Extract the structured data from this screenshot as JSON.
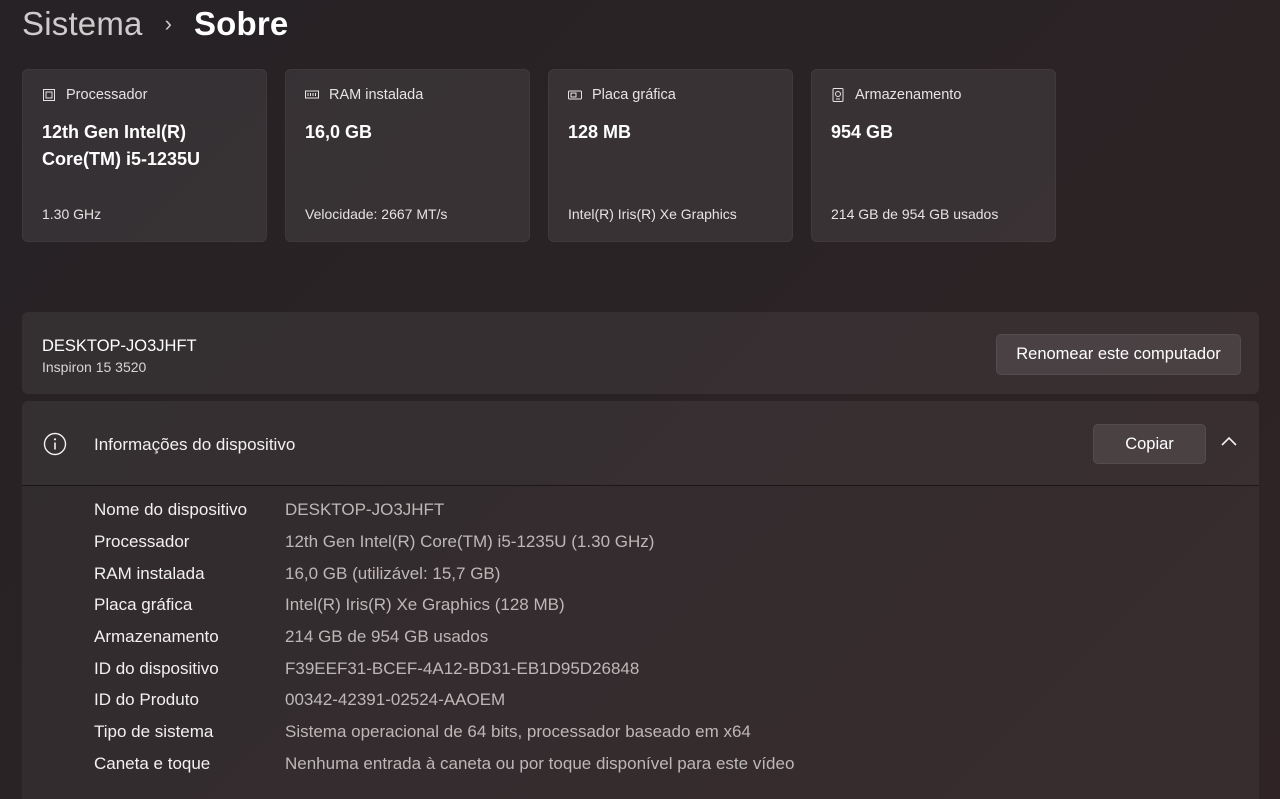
{
  "breadcrumb": {
    "parent": "Sistema",
    "separator": "›",
    "current": "Sobre"
  },
  "cards": [
    {
      "icon": "processor-icon",
      "label": "Processador",
      "value": "12th Gen Intel(R) Core(TM) i5-1235U",
      "sub": "1.30 GHz"
    },
    {
      "icon": "ram-icon",
      "label": "RAM instalada",
      "value": "16,0 GB",
      "sub": "Velocidade: 2667 MT/s"
    },
    {
      "icon": "gpu-icon",
      "label": "Placa gráfica",
      "value": "128 MB",
      "sub": "Intel(R) Iris(R) Xe Graphics"
    },
    {
      "icon": "storage-icon",
      "label": "Armazenamento",
      "value": "954 GB",
      "sub": "214 GB de 954 GB usados"
    }
  ],
  "computer": {
    "name": "DESKTOP-JO3JHFT",
    "model": "Inspiron 15 3520",
    "rename_label": "Renomear este computador"
  },
  "device_info": {
    "title": "Informações do dispositivo",
    "copy_label": "Copiar",
    "rows": [
      {
        "key": "Nome do dispositivo",
        "value": "DESKTOP-JO3JHFT"
      },
      {
        "key": "Processador",
        "value": "12th Gen Intel(R) Core(TM) i5-1235U (1.30 GHz)"
      },
      {
        "key": "RAM instalada",
        "value": "16,0 GB (utilizável: 15,7 GB)"
      },
      {
        "key": "Placa gráfica",
        "value": "Intel(R) Iris(R) Xe Graphics (128 MB)"
      },
      {
        "key": "Armazenamento",
        "value": "214 GB de 954 GB usados"
      },
      {
        "key": "ID do dispositivo",
        "value": "F39EEF31-BCEF-4A12-BD31-EB1D95D26848"
      },
      {
        "key": "ID do Produto",
        "value": "00342-42391-02524-AAOEM"
      },
      {
        "key": "Tipo de sistema",
        "value": "Sistema operacional de 64 bits, processador baseado em x64"
      },
      {
        "key": "Caneta e toque",
        "value": "Nenhuma entrada à caneta ou por toque disponível para este vídeo"
      }
    ]
  }
}
